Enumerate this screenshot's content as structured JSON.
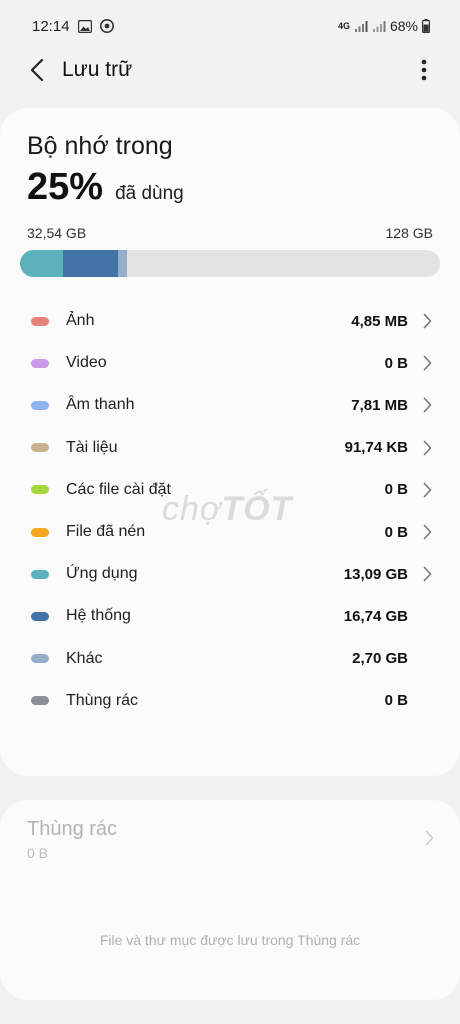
{
  "status_bar": {
    "time": "12:14",
    "network": "4G",
    "battery": "68%"
  },
  "app_bar": {
    "title": "Lưu trữ"
  },
  "internal": {
    "title": "Bộ nhớ trong",
    "percent": "25%",
    "used_label": "đã dùng",
    "used_amount": "32,54 GB",
    "total_amount": "128 GB",
    "bar_segments": [
      {
        "name": "Ứng dụng",
        "fraction": 0.1023,
        "color": "#5bb2bd"
      },
      {
        "name": "Hệ thống",
        "fraction": 0.1308,
        "color": "#4373a8"
      },
      {
        "name": "Khác",
        "fraction": 0.0211,
        "color": "#97aecb"
      }
    ]
  },
  "categories": [
    {
      "label": "Ảnh",
      "size": "4,85 MB",
      "color": "#e8837c",
      "chevron": true
    },
    {
      "label": "Video",
      "size": "0 B",
      "color": "#c99be8",
      "chevron": true
    },
    {
      "label": "Âm thanh",
      "size": "7,81 MB",
      "color": "#8fb2f0",
      "chevron": true
    },
    {
      "label": "Tài liệu",
      "size": "91,74 KB",
      "color": "#c7b18f",
      "chevron": true
    },
    {
      "label": "Các file cài đặt",
      "size": "0 B",
      "color": "#a6d63d",
      "chevron": true
    },
    {
      "label": "File đã nén",
      "size": "0 B",
      "color": "#f5a623",
      "chevron": true
    },
    {
      "label": "Ứng dụng",
      "size": "13,09 GB",
      "color": "#5bb2bd",
      "chevron": true
    },
    {
      "label": "Hệ thống",
      "size": "16,74 GB",
      "color": "#4373a8",
      "chevron": false
    },
    {
      "label": "Khác",
      "size": "2,70 GB",
      "color": "#97aecb",
      "chevron": false
    },
    {
      "label": "Thùng rác",
      "size": "0 B",
      "color": "#8a8e98",
      "chevron": false
    }
  ],
  "trash": {
    "title": "Thùng rác",
    "size": "0 B",
    "description": "File và thư mục được lưu trong Thùng rác"
  },
  "watermark": {
    "part1": "chợ",
    "part2": "TỐT"
  }
}
